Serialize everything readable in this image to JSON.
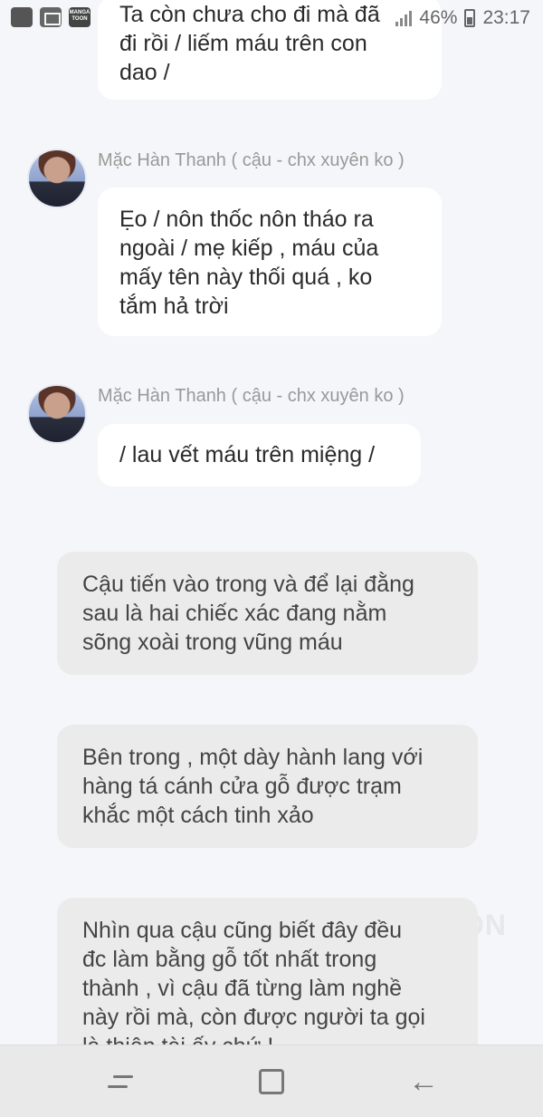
{
  "status_bar": {
    "battery_percent": "46%",
    "time": "23:17",
    "manga_icon_text": "MANGA TOON"
  },
  "messages": [
    {
      "lines": [
        "Ta còn chưa cho đi mà đã",
        "đi rồi / liếm máu trên con",
        "dao /"
      ]
    },
    {
      "sender": "Mặc Hàn Thanh ( cậu - chx xuyên ko )",
      "lines": [
        "Ẹo / nôn thốc nôn tháo ra",
        "ngoài / mẹ kiếp , máu của",
        "mấy tên này thối quá , ko",
        "tắm hả trời"
      ]
    },
    {
      "sender": "Mặc Hàn Thanh ( cậu - chx xuyên ko )",
      "lines": [
        "/ lau vết máu trên miệng /"
      ]
    }
  ],
  "narrations": [
    {
      "lines": [
        "Cậu tiến vào trong và để lại đằng",
        "sau là hai chiếc xác đang nằm",
        "sõng xoài trong vũng máu"
      ]
    },
    {
      "lines": [
        "Bên trong , một dày hành lang với",
        "hàng tá cánh cửa gỗ được trạm",
        "khắc một cách tinh xảo"
      ]
    },
    {
      "lines": [
        "Nhìn qua cậu cũng biết đây đều",
        "đc làm bằng gỗ tốt nhất trong",
        "thành , vì cậu đã từng làm nghề",
        "này rồi mà, còn được người ta gọi",
        "là thiên tài ấy chứ !"
      ]
    }
  ],
  "watermark": "ON",
  "nav": {
    "recent": "recent-apps-icon",
    "home": "home-icon",
    "back": "back-icon"
  }
}
